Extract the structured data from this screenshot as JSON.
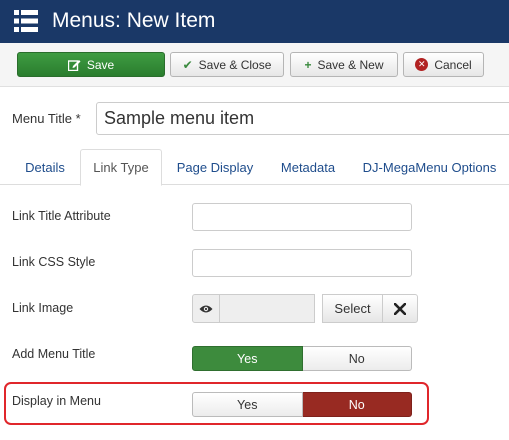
{
  "header": {
    "title": "Menus: New Item",
    "icon": "list-icon",
    "bg_color": "#1a3867"
  },
  "toolbar": {
    "save_label": "Save",
    "save_close_label": "Save & Close",
    "save_new_label": "Save & New",
    "cancel_label": "Cancel"
  },
  "menu_title": {
    "label": "Menu Title *",
    "value": "Sample menu item"
  },
  "tabs": [
    {
      "label": "Details",
      "active": false
    },
    {
      "label": "Link Type",
      "active": true
    },
    {
      "label": "Page Display",
      "active": false
    },
    {
      "label": "Metadata",
      "active": false
    },
    {
      "label": "DJ-MegaMenu Options",
      "active": false
    }
  ],
  "form": {
    "link_title_attribute": {
      "label": "Link Title Attribute",
      "value": ""
    },
    "link_css_style": {
      "label": "Link CSS Style",
      "value": ""
    },
    "link_image": {
      "label": "Link Image",
      "select_label": "Select"
    },
    "add_menu_title": {
      "label": "Add Menu Title",
      "yes": "Yes",
      "no": "No",
      "selected": "Yes"
    },
    "display_in_menu": {
      "label": "Display in Menu",
      "yes": "Yes",
      "no": "No",
      "selected": "No"
    }
  },
  "colors": {
    "yes_active": "#3d8b3d",
    "no_active": "#982a22",
    "highlight": "#e0262b",
    "save_button": "#3a8f3d"
  }
}
